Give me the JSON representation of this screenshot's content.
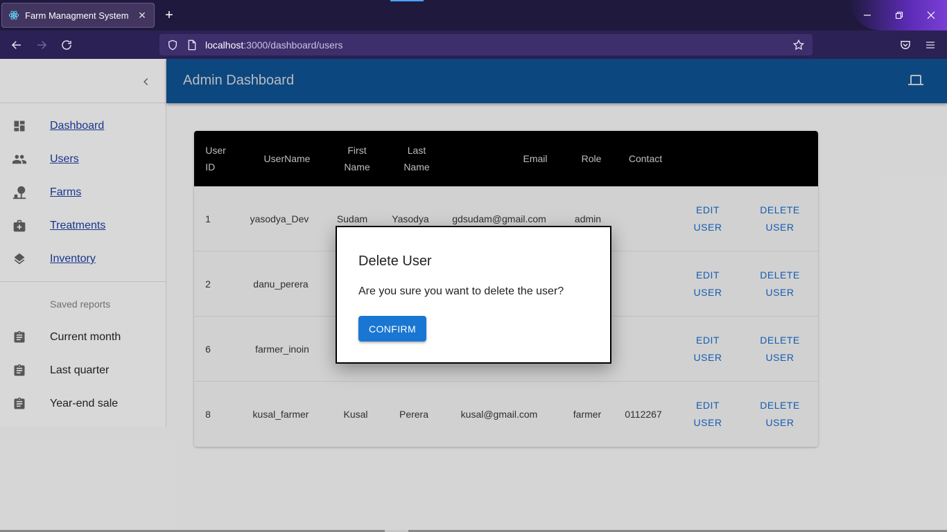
{
  "browser": {
    "tab_title": "Farm Managment System",
    "url_host": "localhost",
    "url_path": ":3000/dashboard/users"
  },
  "appbar": {
    "title": "Admin Dashboard"
  },
  "sidebar": {
    "nav": [
      {
        "label": "Dashboard",
        "icon": "dashboard-icon"
      },
      {
        "label": "Users",
        "icon": "people-icon"
      },
      {
        "label": "Farms",
        "icon": "farm-icon"
      },
      {
        "label": "Treatments",
        "icon": "medical-kit-icon"
      },
      {
        "label": "Inventory",
        "icon": "layers-icon"
      }
    ],
    "saved_header": "Saved reports",
    "reports": [
      {
        "label": "Current month",
        "icon": "assignment-icon"
      },
      {
        "label": "Last quarter",
        "icon": "assignment-icon"
      },
      {
        "label": "Year-end sale",
        "icon": "assignment-icon"
      }
    ]
  },
  "table": {
    "headers": {
      "user_id_1": "User",
      "user_id_2": "ID",
      "username": "UserName",
      "first_1": "First",
      "first_2": "Name",
      "last_1": "Last",
      "last_2": "Name",
      "email": "Email",
      "role": "Role",
      "contact": "Contact"
    },
    "rows": [
      {
        "id": "1",
        "username": "yasodya_Dev",
        "first": "Sudam",
        "last": "Yasodya",
        "email": "gdsudam@gmail.com",
        "role": "admin",
        "contact": ""
      },
      {
        "id": "2",
        "username": "danu_perera",
        "first": "",
        "last": "",
        "email": "",
        "role": "",
        "contact": ""
      },
      {
        "id": "6",
        "username": "farmer_inoin",
        "first": "",
        "last": "",
        "email": "",
        "role": "",
        "contact": ""
      },
      {
        "id": "8",
        "username": "kusal_farmer",
        "first": "Kusal",
        "last": "Perera",
        "email": "kusal@gmail.com",
        "role": "farmer",
        "contact": "0112267"
      }
    ],
    "edit_1": "EDIT",
    "edit_2": "USER",
    "delete_1": "DELETE",
    "delete_2": "USER"
  },
  "dialog": {
    "title": "Delete User",
    "message": "Are you sure you want to delete the user?",
    "confirm_label": "CONFIRM"
  }
}
